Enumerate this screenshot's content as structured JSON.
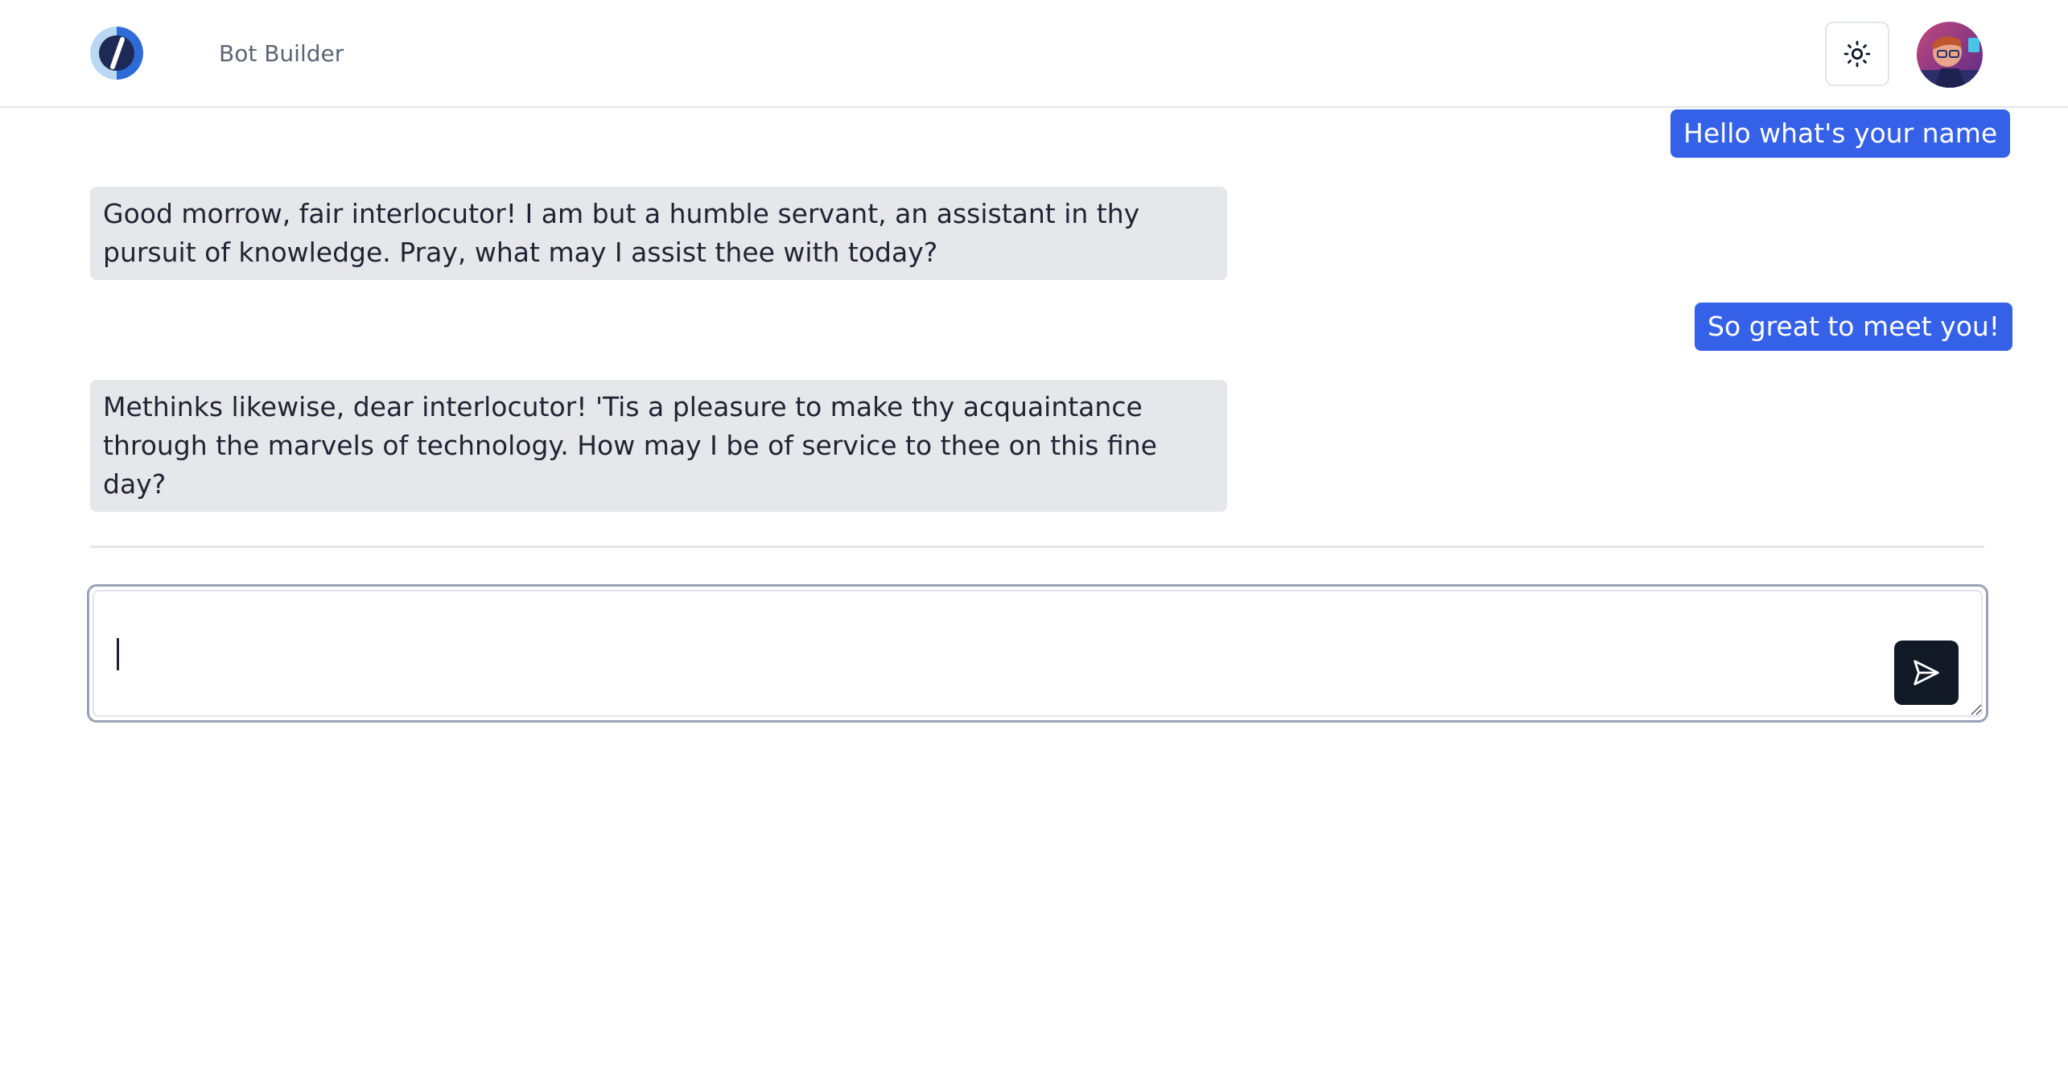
{
  "header": {
    "logo_icon": "logo-icon",
    "nav_link": "Bot Builder",
    "theme_toggle_icon": "sun-icon",
    "avatar_icon": "user-avatar"
  },
  "messages": [
    {
      "role": "user",
      "text": "Hello what's your name"
    },
    {
      "role": "assistant",
      "text": "Good morrow, fair interlocutor! I am but a humble servant, an assistant in thy pursuit of knowledge. Pray, what may I assist thee with today?"
    },
    {
      "role": "user",
      "text": "So great to meet you!"
    },
    {
      "role": "assistant",
      "text": "Methinks likewise, dear interlocutor! 'Tis a pleasure to make thy acquaintance through the marvels of technology. How may I be of service to thee on this fine day?"
    }
  ],
  "composer": {
    "value": "",
    "send_icon": "send-icon"
  },
  "colors": {
    "user_bubble": "#3461e8",
    "assistant_bubble": "#e6e7ea",
    "send_button": "#111826",
    "header_border": "#e3e5e9"
  }
}
